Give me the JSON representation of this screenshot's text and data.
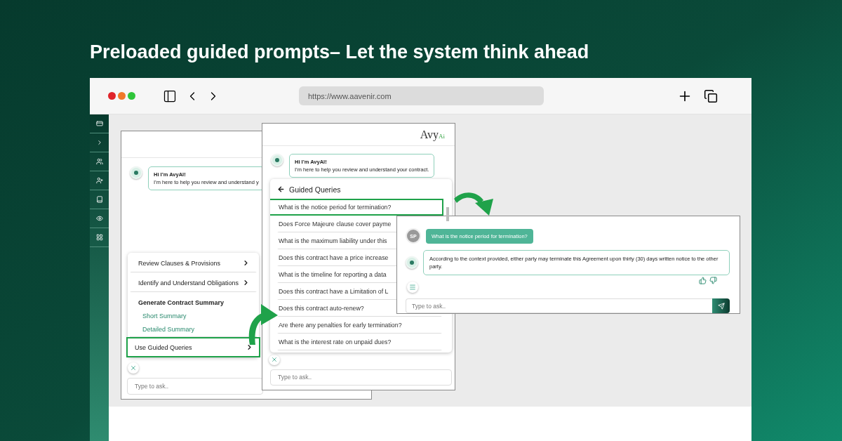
{
  "headline": "Preloaded guided prompts– Let the system think ahead",
  "browser": {
    "url": "https://www.aavenir.com"
  },
  "panel_menu": {
    "greeting": {
      "title": "Hi I’m AvyAI!",
      "text": "I’m here to help you review and understand y"
    },
    "menu": [
      {
        "kind": "link",
        "label": "Review Clauses & Provisions",
        "highlighted": false
      },
      {
        "kind": "link",
        "label": "Identify and Understand Obligations",
        "highlighted": false
      },
      {
        "kind": "group",
        "label": "Generate Contract Summary",
        "options": [
          "Short Summary",
          "Detailed Summary"
        ]
      },
      {
        "kind": "link",
        "label": "Use Guided Queries",
        "highlighted": true
      }
    ],
    "input": {
      "placeholder": "Type to ask.."
    }
  },
  "panel_queries": {
    "logo": {
      "name": "Avy",
      "suffix": "Ai"
    },
    "greeting": {
      "title": "Hi I’m AvyAI!",
      "text": "I’m here to help you review and understand your contract."
    },
    "title": "Guided Queries",
    "queries": [
      {
        "text": "What is the notice period for termination?",
        "highlighted": true
      },
      {
        "text": "Does Force Majeure clause cover payme",
        "highlighted": false
      },
      {
        "text": "What is the maximum liability under this",
        "highlighted": false
      },
      {
        "text": "Does this contract have a price increase",
        "highlighted": false
      },
      {
        "text": "What is the timeline for reporting a data",
        "highlighted": false
      },
      {
        "text": "Does this contract have a Limitation of L",
        "highlighted": false
      },
      {
        "text": "Does this contract auto-renew?",
        "highlighted": false
      },
      {
        "text": "Are there any penalties for early termination?",
        "highlighted": false
      },
      {
        "text": "What is the interest rate on unpaid dues?",
        "highlighted": false
      }
    ],
    "input": {
      "placeholder": "Type to ask.."
    }
  },
  "panel_answer": {
    "question": {
      "avatar": "SP",
      "text": "What is the notice period for termination?"
    },
    "answer": "According to the context provided, either party may terminate this Agreement upon thirty (30) days written notice to the other party.",
    "input": {
      "placeholder": "Type to ask.."
    }
  }
}
